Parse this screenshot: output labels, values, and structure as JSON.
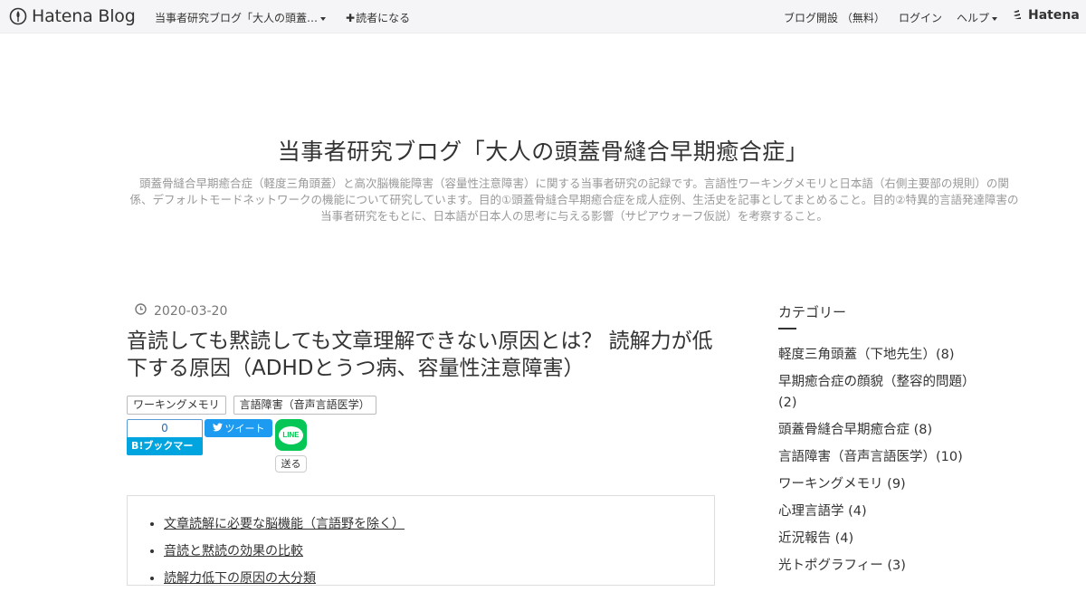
{
  "navbar": {
    "brand": "Hatena Blog",
    "blog_menu": "当事者研究ブログ「大人の頭蓋…",
    "subscribe": "読者になる",
    "open_blog": "ブログ開設 （無料）",
    "login": "ログイン",
    "help": "ヘルプ",
    "hatena": "Hatena"
  },
  "blog": {
    "title": "当事者研究ブログ「大人の頭蓋骨縫合早期癒合症」",
    "description": "頭蓋骨縫合早期癒合症（軽度三角頭蓋）と高次脳機能障害（容量性注意障害）に関する当事者研究の記録です。言語性ワーキングメモリと日本語（右側主要部の規則）の関係、デフォルトモードネットワークの機能について研究しています。目的①頭蓋骨縫合早期癒合症を成人症例、生活史を記事としてまとめること。目的②特異的言語発達障害の当事者研究をもとに、日本語が日本人の思考に与える影響（サピアウォーフ仮説）を考察すること。"
  },
  "entry": {
    "date": "2020-03-20",
    "title": "音読しても黙読しても文章理解できない原因とは？ 読解力が低下する原因（ADHDとうつ病、容量性注意障害）",
    "tags": [
      "ワーキングメモリ",
      "言語障害（音声言語医学）"
    ],
    "share": {
      "hatena_count": "0",
      "hatena_label": "B!ブックマーク",
      "tweet_label": "ツイート",
      "line_label": "LINE",
      "send_label": "送る"
    },
    "toc": [
      "文章読解に必要な脳機能（言語野を除く）",
      "音読と黙読の効果の比較",
      "読解力低下の原因の大分類"
    ]
  },
  "sidebar": {
    "heading": "カテゴリー",
    "categories": [
      "軽度三角頭蓋（下地先生）(8)",
      "早期癒合症の顔貌（整容的問題）(2)",
      "頭蓋骨縫合早期癒合症 (8)",
      "言語障害（音声言語医学）(10)",
      "ワーキングメモリ (9)",
      "心理言語学 (4)",
      "近況報告 (4)",
      "光トポグラフィー (3)"
    ]
  },
  "colors": {
    "navbar_bg": "#f5f5f7",
    "hatena_bookmark_blue": "#00a4de",
    "twitter_blue": "#1d9bf0",
    "line_green": "#06c755"
  }
}
